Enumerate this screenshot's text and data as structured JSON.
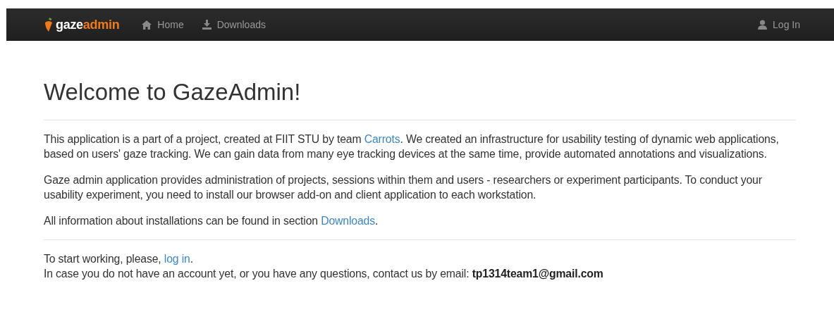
{
  "navbar": {
    "logo": {
      "first": "gaze",
      "second": "admin"
    },
    "links": [
      {
        "label": "Home"
      },
      {
        "label": "Downloads"
      }
    ],
    "login": {
      "label": "Log In"
    }
  },
  "title": "Welcome to GazeAdmin!",
  "sections": [
    {
      "paragraphs": [
        [
          {
            "kind": "text",
            "text": "This application is a part of a project, created at FIIT STU by team "
          },
          {
            "kind": "link",
            "text": "Carrots"
          },
          {
            "kind": "text",
            "text": ". We created an infrastructure for usability testing of dynamic web applications, based on users' gaze tracking. We can gain data from many eye tracking devices at the same time, provide automated annotations and visualizations."
          }
        ],
        [
          {
            "kind": "text",
            "text": "Gaze admin application provides administration of projects, sessions within them and users - researchers or experiment participants. To conduct your usability experiment, you need to install our browser add-on and client application to each workstation."
          }
        ],
        [
          {
            "kind": "text",
            "text": "All information about installations can be found in section "
          },
          {
            "kind": "link",
            "text": "Downloads"
          },
          {
            "kind": "text",
            "text": "."
          }
        ]
      ]
    },
    {
      "paragraphs": [
        [
          {
            "kind": "text",
            "text": "To start working, please, "
          },
          {
            "kind": "link",
            "text": "log in"
          },
          {
            "kind": "text",
            "text": "."
          }
        ],
        [
          {
            "kind": "text",
            "text": "In case you do not have an account yet, or you have any questions, contact us by email: "
          },
          {
            "kind": "bold",
            "text": "tp1314team1@gmail.com"
          }
        ]
      ]
    }
  ]
}
